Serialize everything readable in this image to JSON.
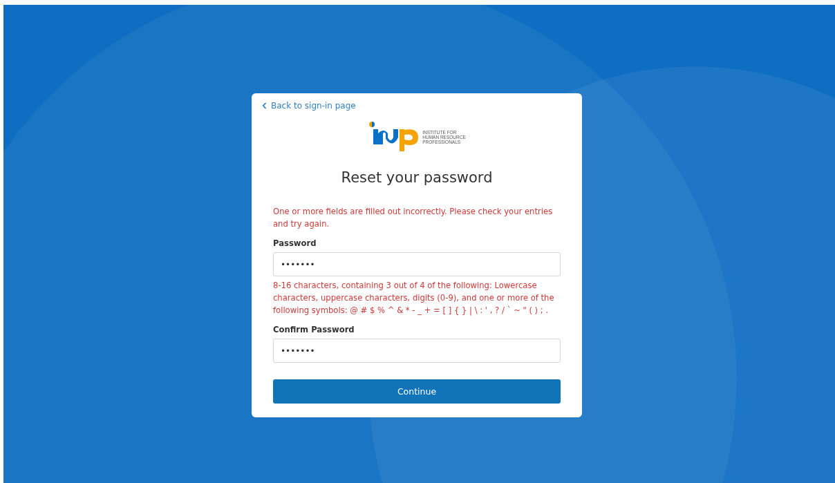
{
  "back_link": {
    "label": "Back to sign-in page"
  },
  "logo": {
    "lines": [
      "INSTITUTE FOR",
      "HUMAN RESOURCE",
      "PROFESSIONALS"
    ]
  },
  "title": "Reset your password",
  "form_error": "One or more fields are filled out incorrectly. Please check your entries and try again.",
  "fields": [
    {
      "label": "Password",
      "value": "•••••••",
      "error": "8-16 characters, containing 3 out of 4 of the following: Lowercase characters, uppercase characters, digits (0-9), and one or more of the following symbols: @ # $ % ^ & * - _ + = [ ] { } | \\ : ' , ? / ` ~ \" ( ) ; ."
    },
    {
      "label": "Confirm Password",
      "value": "•••••••"
    }
  ],
  "submit": {
    "label": "Continue"
  }
}
